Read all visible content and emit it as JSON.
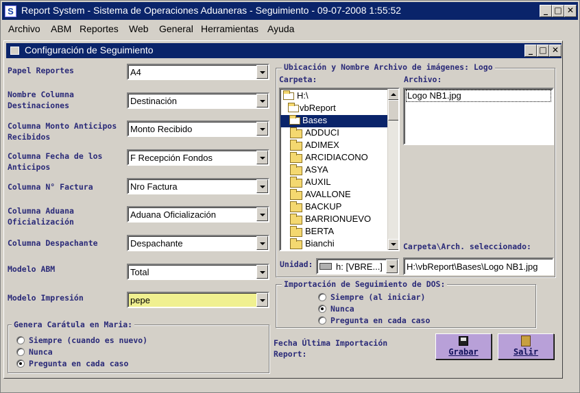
{
  "app": {
    "title": "Report System - Sistema de Operaciones Aduaneras - Seguimiento - 09-07-2008 1:55:52",
    "icon": "app-s-icon"
  },
  "menu": [
    "Archivo",
    "ABM",
    "Reportes",
    "Web",
    "General",
    "Herramientas",
    "Ayuda"
  ],
  "child": {
    "title": "Configuración de Seguimiento"
  },
  "fields": [
    {
      "label": "Papel Reportes",
      "value": "A4"
    },
    {
      "label": "Nombre Columna Destinaciones",
      "value": "Destinación"
    },
    {
      "label": "Columna Monto Anticipos Recibidos",
      "value": "Monto Recibido"
    },
    {
      "label": "Columna Fecha de los Anticipos",
      "value": "F Recepción Fondos"
    },
    {
      "label": "Columna N° Factura",
      "value": "Nro Factura"
    },
    {
      "label": "Columna Aduana Oficialización",
      "value": "Aduana Oficialización"
    },
    {
      "label": "Columna Despachante",
      "value": "Despachante"
    },
    {
      "label": "Modelo ABM",
      "value": "Total"
    },
    {
      "label": "Modelo Impresión",
      "value": "pepe"
    }
  ],
  "caratula": {
    "title": "Genera Carátula en Maria:",
    "options": [
      "Siempre (cuando es nuevo)",
      "Nunca",
      "Pregunta en cada caso"
    ],
    "selected": 2
  },
  "ubicacion": {
    "title": "Ubicación y Nombre Archivo de imágenes: Logo",
    "carpeta_label": "Carpeta:",
    "archivo_label": "Archivo:",
    "folders": [
      "H:\\",
      "vbReport",
      "Bases",
      "ADDUCI",
      "ADIMEX",
      "ARCIDIACONO",
      "ASYA",
      "AUXIL",
      "AVALLONE",
      "BACKUP",
      "BARRIONUEVO",
      "BERTA",
      "Bianchi"
    ],
    "selected_folder": "Bases",
    "files": [
      "Logo NB1.jpg"
    ],
    "unidad_label": "Unidad:",
    "unidad_value": "h: [VBRE...]",
    "seleccionado_label": "Carpeta\\Arch. seleccionado:",
    "seleccionado_value": "H:\\vbReport\\Bases\\Logo NB1.jpg"
  },
  "importacion": {
    "title": "Importación de Seguimiento de DOS:",
    "options": [
      "Siempre (al iniciar)",
      "Nunca",
      "Pregunta en cada caso"
    ],
    "selected": 1
  },
  "fecha_label": "Fecha Última Importación Report:",
  "buttons": {
    "grabar": "Grabar",
    "salir": "Salir"
  }
}
